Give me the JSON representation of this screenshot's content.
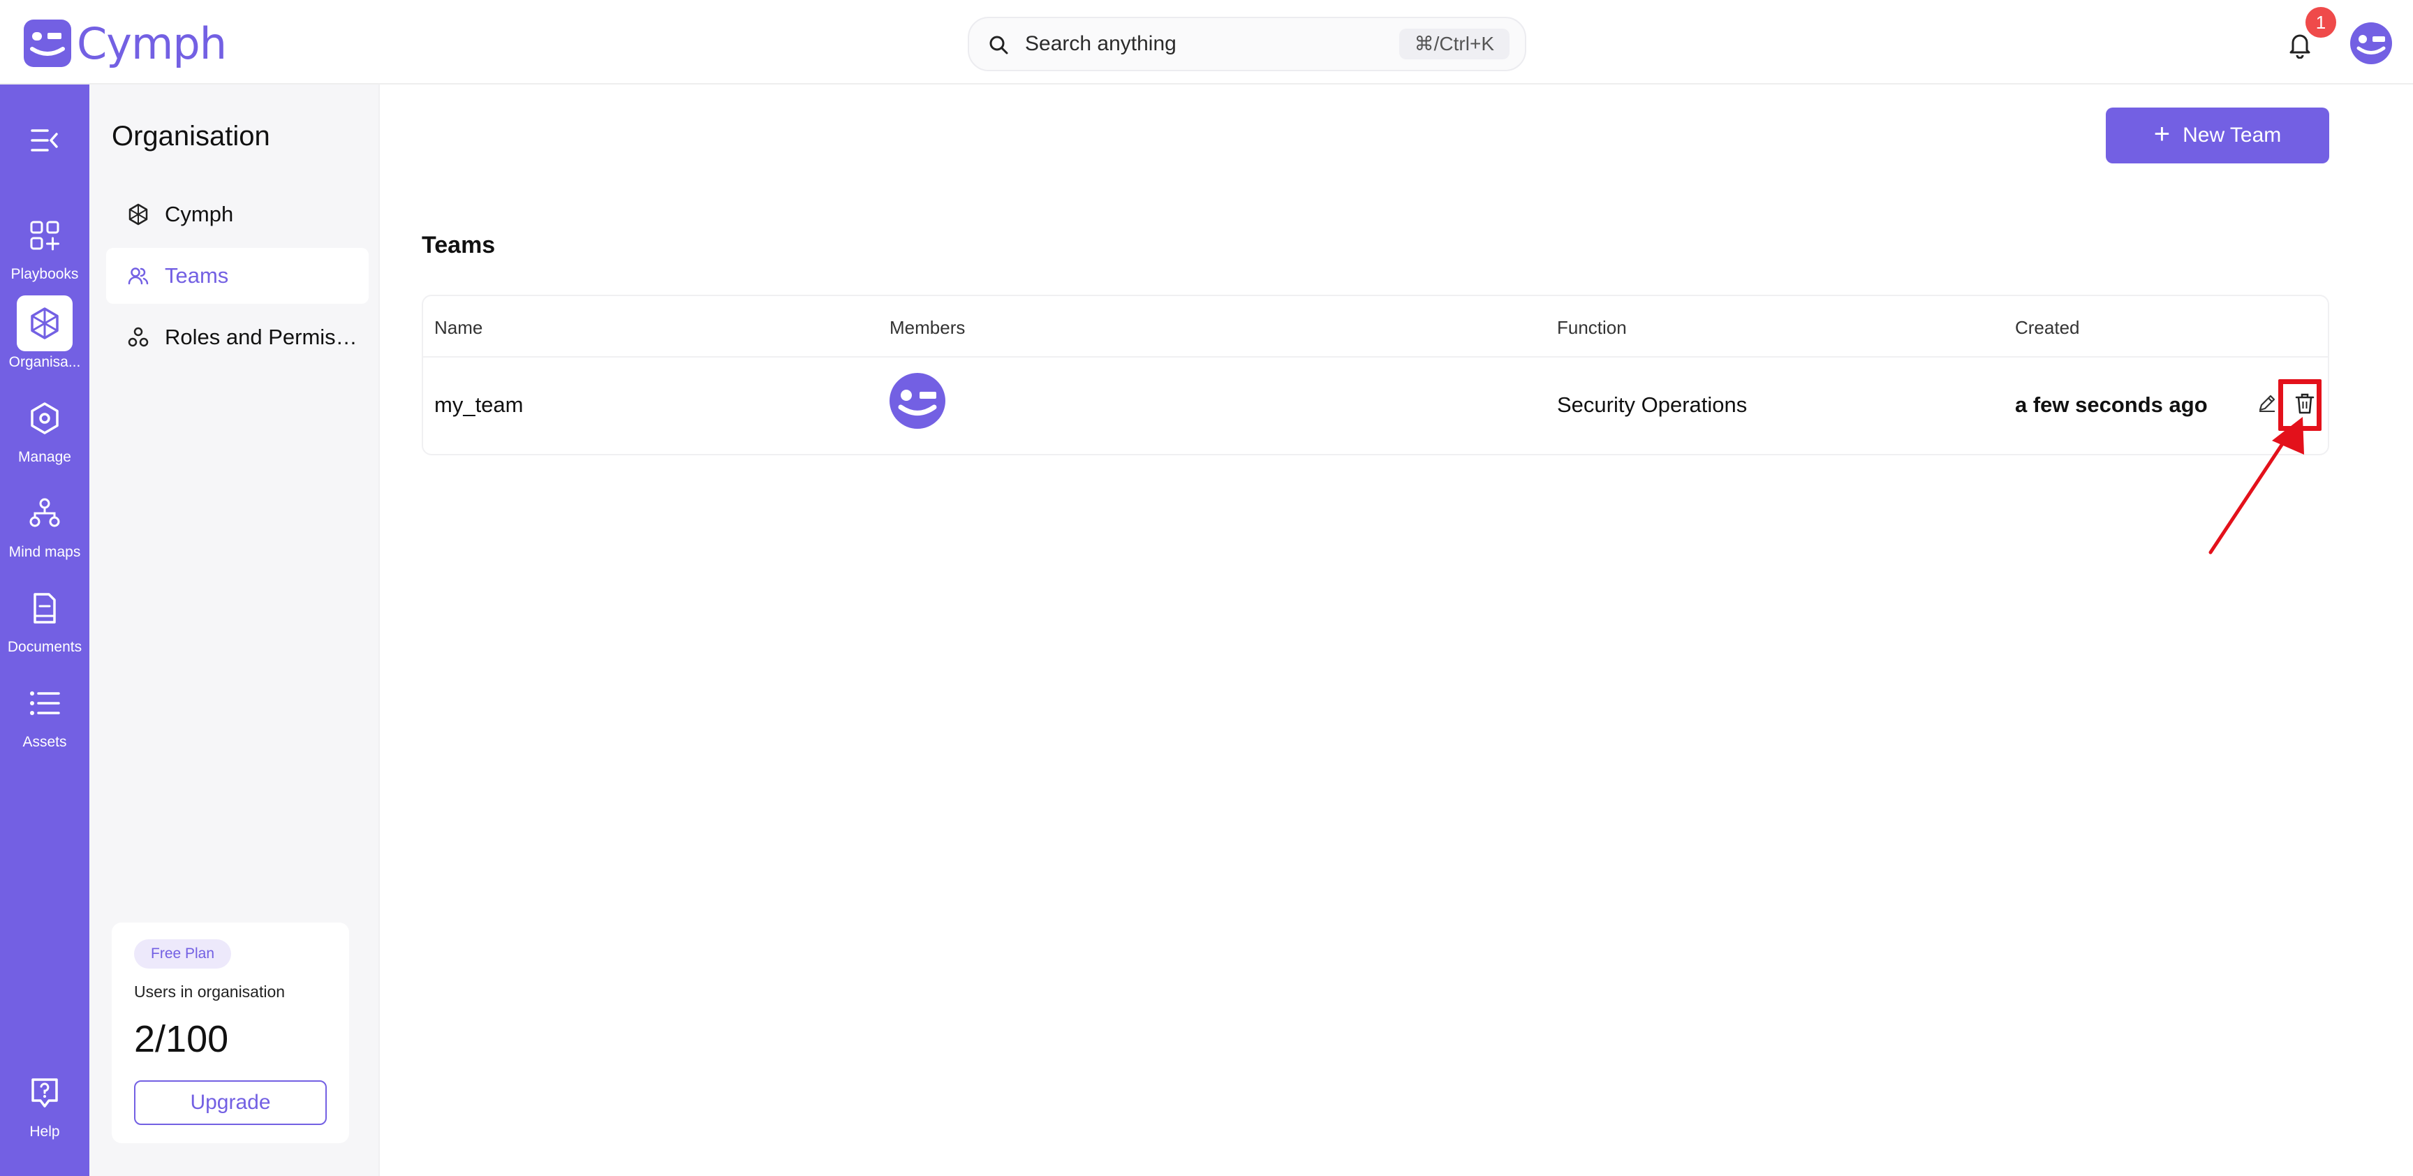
{
  "app": {
    "logo_text": "Cymph",
    "search": {
      "placeholder": "Search anything",
      "shortcut": "⌘/Ctrl+K"
    },
    "notifications": {
      "count": "1"
    }
  },
  "rail": {
    "items": [
      {
        "label": "Playbooks",
        "icon": "playbooks-icon",
        "active": false
      },
      {
        "label": "Organisa...",
        "icon": "organisation-icon",
        "active": true
      },
      {
        "label": "Manage",
        "icon": "manage-icon",
        "active": false
      },
      {
        "label": "Mind maps",
        "icon": "mind-maps-icon",
        "active": false
      },
      {
        "label": "Documents",
        "icon": "documents-icon",
        "active": false
      },
      {
        "label": "Assets",
        "icon": "assets-icon",
        "active": false
      },
      {
        "label": "Help",
        "icon": "help-icon",
        "active": false
      }
    ]
  },
  "subnav": {
    "title": "Organisation",
    "items": [
      {
        "label": "Cymph",
        "icon": "organisation-icon",
        "active": false
      },
      {
        "label": "Teams",
        "icon": "teams-icon",
        "active": true
      },
      {
        "label": "Roles and Permissions",
        "icon": "roles-icon",
        "active": false
      }
    ],
    "plan": {
      "badge": "Free Plan",
      "users_label": "Users in organisation",
      "users_count": "2/100",
      "upgrade_label": "Upgrade"
    }
  },
  "main": {
    "new_team_label": "New Team",
    "section_title": "Teams",
    "table": {
      "columns": [
        "Name",
        "Members",
        "Function",
        "Created"
      ],
      "rows": [
        {
          "name": "my_team",
          "members": [
            "member-avatar"
          ],
          "function": "Security Operations",
          "created": "a few seconds ago"
        }
      ]
    }
  },
  "colors": {
    "brand": "#7360e3",
    "badge": "#ef4a4a",
    "annotation": "#e3111b"
  }
}
